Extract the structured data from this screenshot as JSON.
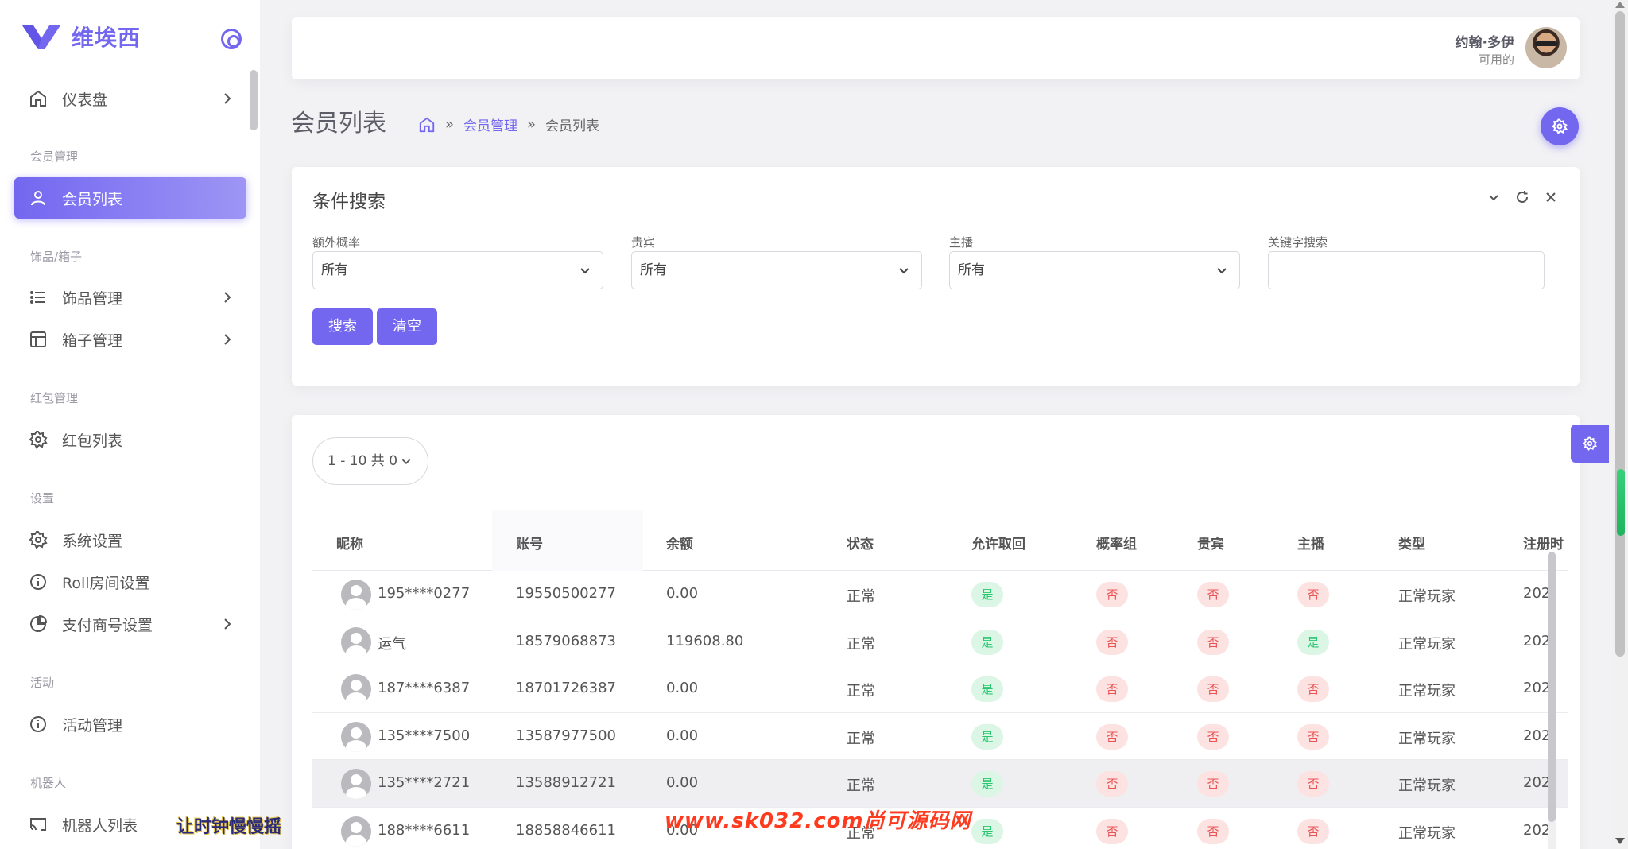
{
  "brand": {
    "name": "维埃西"
  },
  "sidebar": {
    "dashboard": "仪表盘",
    "sections": {
      "member": "会员管理",
      "items": "饰品/箱子",
      "redpacket": "红包管理",
      "settings": "设置",
      "activity": "活动",
      "robot": "机器人"
    },
    "items": {
      "member_list": "会员列表",
      "item_manage": "饰品管理",
      "box_manage": "箱子管理",
      "redpacket_list": "红包列表",
      "system_settings": "系统设置",
      "roll_settings": "Roll房间设置",
      "payment_settings": "支付商号设置",
      "activity_manage": "活动管理",
      "robot_list": "机器人列表"
    }
  },
  "overlay_text": "让时钟慢慢摇",
  "user": {
    "name": "约翰·多伊",
    "status": "可用的"
  },
  "page": {
    "title": "会员列表",
    "breadcrumb": {
      "sep": "»",
      "parent": "会员管理",
      "current": "会员列表"
    }
  },
  "search": {
    "title": "条件搜索",
    "fields": [
      {
        "label": "额外概率",
        "value": "所有"
      },
      {
        "label": "贵宾",
        "value": "所有"
      },
      {
        "label": "主播",
        "value": "所有"
      },
      {
        "label": "关键字搜索",
        "value": ""
      }
    ],
    "search_button": "搜索",
    "clear_button": "清空"
  },
  "table": {
    "pager": "1 - 10 共 0",
    "columns": [
      "昵称",
      "账号",
      "余额",
      "状态",
      "允许取回",
      "概率组",
      "贵宾",
      "主播",
      "类型",
      "注册时"
    ],
    "rows": [
      {
        "nickname": "195****0277",
        "account": "19550500277",
        "balance": "0.00",
        "status": "正常",
        "allow_withdraw": "是",
        "prob_group": "否",
        "vip": "否",
        "streamer": "否",
        "type": "正常玩家",
        "registered": "202"
      },
      {
        "nickname": "运气",
        "account": "18579068873",
        "balance": "119608.80",
        "status": "正常",
        "allow_withdraw": "是",
        "prob_group": "否",
        "vip": "否",
        "streamer": "是",
        "type": "正常玩家",
        "registered": "202"
      },
      {
        "nickname": "187****6387",
        "account": "18701726387",
        "balance": "0.00",
        "status": "正常",
        "allow_withdraw": "是",
        "prob_group": "否",
        "vip": "否",
        "streamer": "否",
        "type": "正常玩家",
        "registered": "202"
      },
      {
        "nickname": "135****7500",
        "account": "13587977500",
        "balance": "0.00",
        "status": "正常",
        "allow_withdraw": "是",
        "prob_group": "否",
        "vip": "否",
        "streamer": "否",
        "type": "正常玩家",
        "registered": "202"
      },
      {
        "nickname": "135****2721",
        "account": "13588912721",
        "balance": "0.00",
        "status": "正常",
        "allow_withdraw": "是",
        "prob_group": "否",
        "vip": "否",
        "streamer": "否",
        "type": "正常玩家",
        "registered": "202"
      },
      {
        "nickname": "188****6611",
        "account": "18858846611",
        "balance": "0.00",
        "status": "正常",
        "allow_withdraw": "是",
        "prob_group": "否",
        "vip": "否",
        "streamer": "否",
        "type": "正常玩家",
        "registered": "202"
      }
    ]
  },
  "watermark": "www.sk032.com尚可源码网",
  "colors": {
    "primary": "#7367f0",
    "success": "#28c76f",
    "danger": "#ea5455"
  }
}
